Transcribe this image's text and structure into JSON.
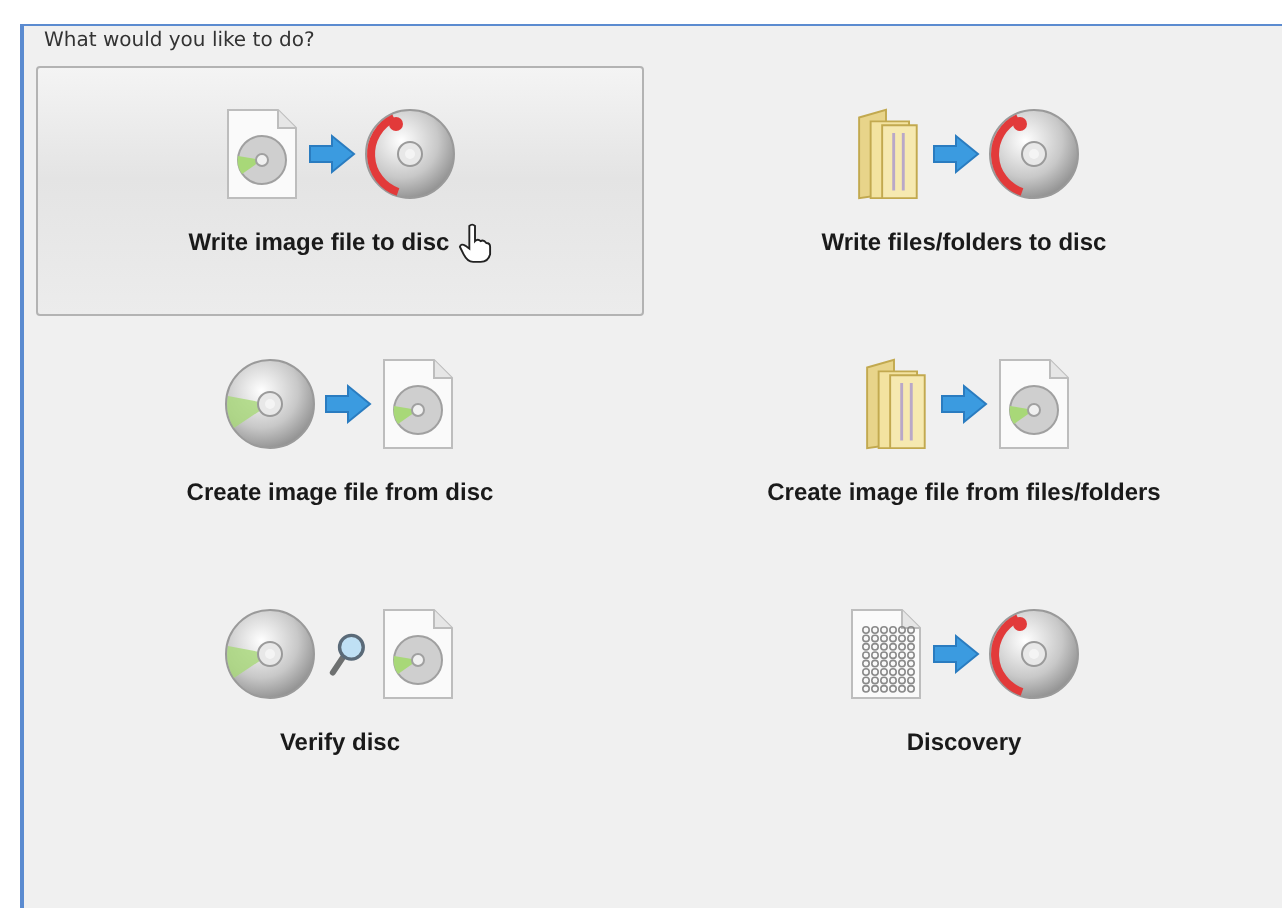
{
  "panel": {
    "heading": "What would you like to do?",
    "tasks": [
      {
        "label": "Write image file to disc",
        "kind": "write-image",
        "selected": true
      },
      {
        "label": "Write files/folders to disc",
        "kind": "write-files",
        "selected": false
      },
      {
        "label": "Create image file from disc",
        "kind": "create-image-disc",
        "selected": false
      },
      {
        "label": "Create image file from files/folders",
        "kind": "create-image-files",
        "selected": false
      },
      {
        "label": "Verify disc",
        "kind": "verify",
        "selected": false
      },
      {
        "label": "Discovery",
        "kind": "discovery",
        "selected": false
      }
    ]
  }
}
